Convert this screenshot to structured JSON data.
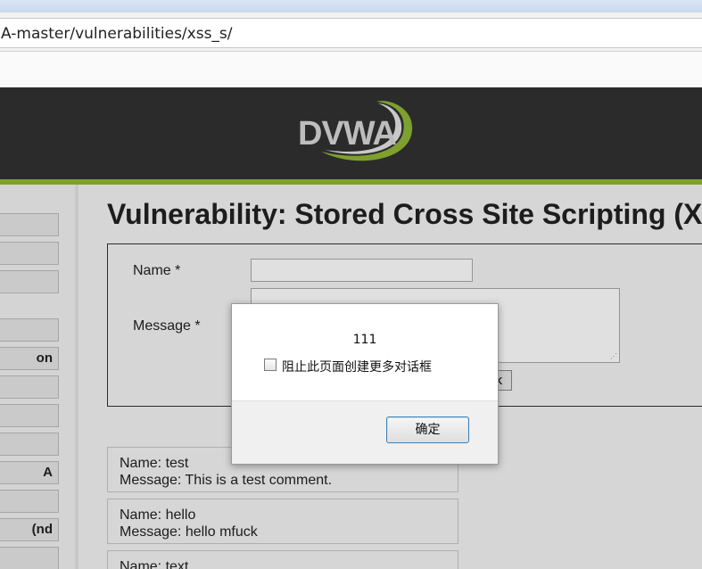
{
  "browser": {
    "url": "A-master/vulnerabilities/xss_s/"
  },
  "header": {
    "logo_text": "DVWA"
  },
  "sidebar": {
    "items": [
      {
        "label": ""
      },
      {
        "label": ""
      },
      {
        "label": ""
      },
      {
        "label": ""
      },
      {
        "label": "on"
      },
      {
        "label": ""
      },
      {
        "label": ""
      },
      {
        "label": ""
      },
      {
        "label": "A"
      },
      {
        "label": ""
      },
      {
        "label": "nd)"
      },
      {
        "label": ""
      }
    ]
  },
  "main": {
    "title": "Vulnerability: Stored Cross Site Scripting (X",
    "form": {
      "name_label": "Name *",
      "message_label": "Message *",
      "name_value": "",
      "message_value": "",
      "submit_label": "k"
    },
    "entries": [
      {
        "name": "Name: test",
        "message": "Message: This is a test comment."
      },
      {
        "name": "Name: hello",
        "message": "Message: hello mfuck"
      },
      {
        "name": "Name: text",
        "message": ""
      }
    ]
  },
  "dialog": {
    "message": "111",
    "checkbox_label": "阻止此页面创建更多对话框",
    "checkbox_checked": false,
    "ok_label": "确定"
  },
  "colors": {
    "header_bg": "#2b2b2b",
    "accent_green": "#7ea02e",
    "dialog_button_border": "#3c7fb1"
  }
}
